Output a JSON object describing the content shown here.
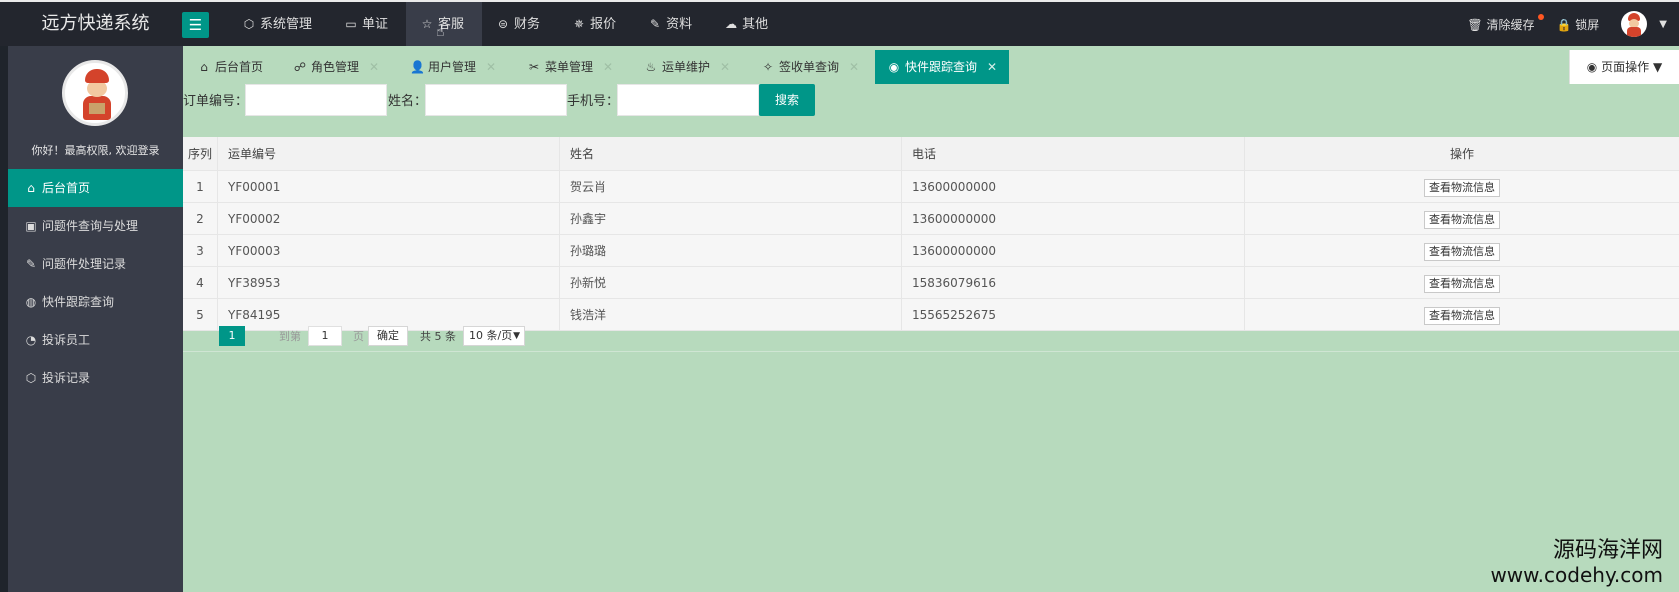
{
  "app": {
    "title": "远方快递系统"
  },
  "topnav": [
    {
      "label": "系统管理",
      "icon": "cube-icon"
    },
    {
      "label": "单证",
      "icon": "book-icon"
    },
    {
      "label": "客服",
      "icon": "star-icon",
      "active": true
    },
    {
      "label": "财务",
      "icon": "dollar-icon"
    },
    {
      "label": "报价",
      "icon": "sun-icon"
    },
    {
      "label": "资料",
      "icon": "edit-icon"
    },
    {
      "label": "其他",
      "icon": "cloud-icon"
    }
  ],
  "topright": {
    "clear_cache": "清除缓存",
    "lock": "锁屏"
  },
  "sidebar": {
    "welcome": "你好！最高权限, 欢迎登录",
    "items": [
      {
        "label": "后台首页",
        "icon": "home-icon",
        "active": true
      },
      {
        "label": "问题件查询与处理",
        "icon": "qrcode-icon"
      },
      {
        "label": "问题件处理记录",
        "icon": "edit-icon"
      },
      {
        "label": "快件跟踪查询",
        "icon": "globe-icon"
      },
      {
        "label": "投诉员工",
        "icon": "chat-icon"
      },
      {
        "label": "投诉记录",
        "icon": "cube-icon"
      }
    ]
  },
  "tabs": [
    {
      "label": "后台首页",
      "icon": "home-icon"
    },
    {
      "label": "角色管理",
      "icon": "users-icon"
    },
    {
      "label": "用户管理",
      "icon": "user-icon"
    },
    {
      "label": "菜单管理",
      "icon": "tools-icon"
    },
    {
      "label": "运单维护",
      "icon": "fire-icon"
    },
    {
      "label": "签收单查询",
      "icon": "sign-icon"
    },
    {
      "label": "快件跟踪查询",
      "icon": "github-icon",
      "active": true
    }
  ],
  "page_ops": "页面操作",
  "search": {
    "order_label": "订单编号：",
    "name_label": "姓名：",
    "phone_label": "手机号：",
    "button": "搜索"
  },
  "table": {
    "headers": [
      "序列",
      "运单编号",
      "姓名",
      "电话",
      "操作"
    ],
    "rows": [
      {
        "index": "1",
        "waybill": "YF00001",
        "name": "贺云肖",
        "phone": "13600000000",
        "action": "查看物流信息"
      },
      {
        "index": "2",
        "waybill": "YF00002",
        "name": "孙鑫宇",
        "phone": "13600000000",
        "action": "查看物流信息"
      },
      {
        "index": "3",
        "waybill": "YF00003",
        "name": "孙璐璐",
        "phone": "13600000000",
        "action": "查看物流信息"
      },
      {
        "index": "4",
        "waybill": "YF38953",
        "name": "孙新悦",
        "phone": "15836079616",
        "action": "查看物流信息"
      },
      {
        "index": "5",
        "waybill": "YF84195",
        "name": "钱浩洋",
        "phone": "15565252675",
        "action": "查看物流信息"
      }
    ]
  },
  "pager": {
    "current": "1",
    "goto_prefix": "到第",
    "goto_value": "1",
    "goto_suffix": "页",
    "confirm": "确定",
    "total": "共 5 条",
    "page_size": "10 条/页"
  },
  "watermark": {
    "line1": "源码海洋网",
    "line2": "www.codehy.com"
  },
  "colors": {
    "accent": "#009688",
    "content_bg": "#b7dabd",
    "sidebar": "#393d49",
    "topbar": "#23262e"
  }
}
